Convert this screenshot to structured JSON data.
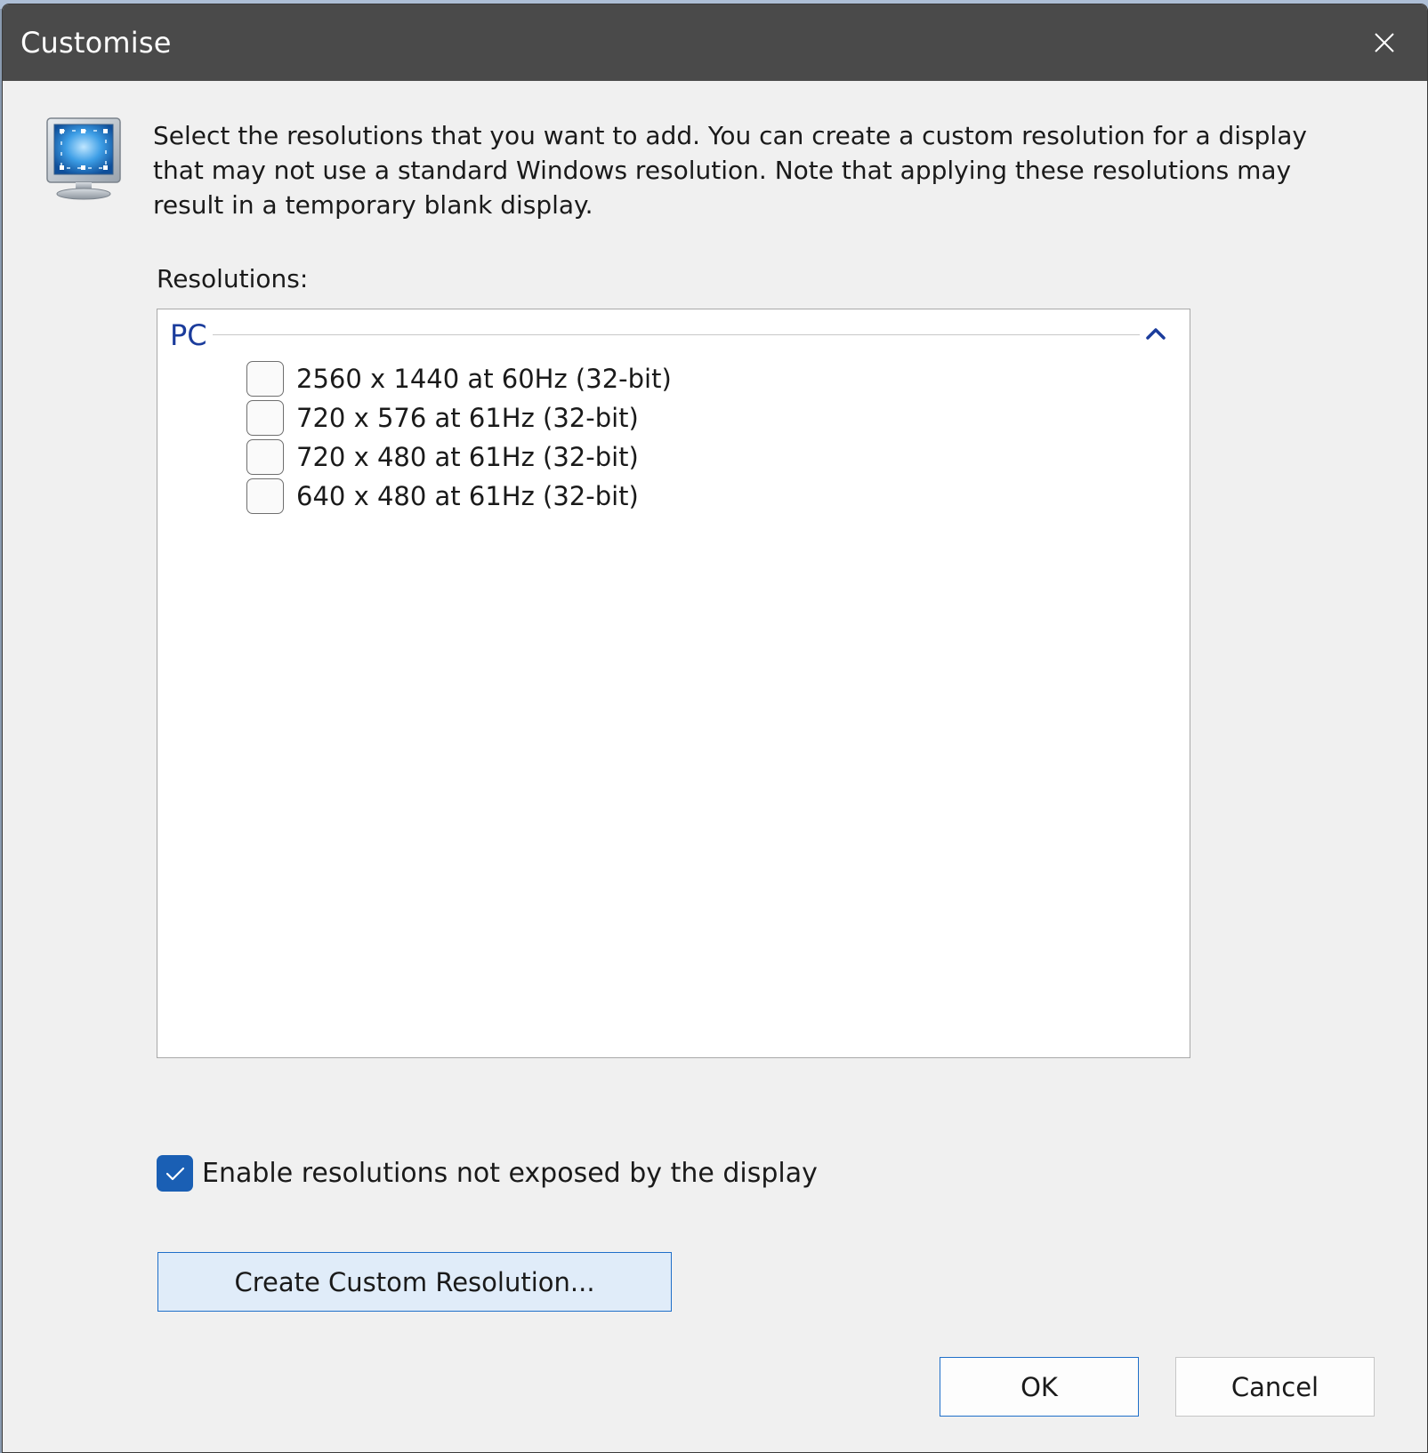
{
  "dialog": {
    "title": "Customise",
    "description": "Select the resolutions that you want to add. You can create a custom resolution for a display that may not use a standard Windows resolution. Note that applying these resolutions may result in a temporary blank display."
  },
  "resolutions": {
    "label": "Resolutions:",
    "group_title": "PC",
    "items": [
      {
        "label": "2560 x 1440 at 60Hz (32-bit)",
        "checked": false
      },
      {
        "label": "720 x 576 at 61Hz (32-bit)",
        "checked": false
      },
      {
        "label": "720 x 480 at 61Hz (32-bit)",
        "checked": false
      },
      {
        "label": "640 x 480 at 61Hz (32-bit)",
        "checked": false
      }
    ]
  },
  "enable_option": {
    "label": "Enable resolutions not exposed by the display",
    "checked": true
  },
  "buttons": {
    "create_custom": "Create Custom Resolution...",
    "ok": "OK",
    "cancel": "Cancel"
  },
  "icons": {
    "close": "close-icon",
    "monitor": "monitor-icon",
    "collapse": "chevron-up-icon",
    "check": "checkmark-icon"
  },
  "colors": {
    "titlebar": "#4a4a4a",
    "accent": "#1a5fb4",
    "group_title": "#1b3c9c",
    "button_border_focus": "#1f6fc9"
  }
}
